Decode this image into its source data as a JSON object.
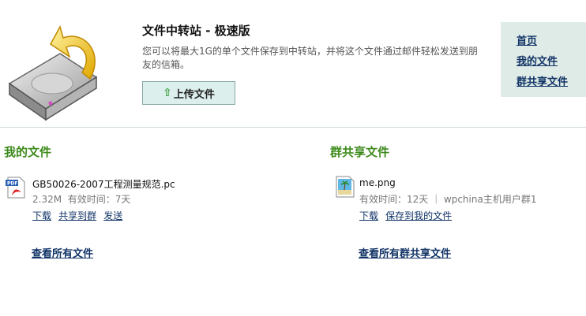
{
  "header": {
    "title": "文件中转站 - 极速版",
    "description": "您可以将最大1G的单个文件保存到中转站，并将这个文件通过邮件轻松发送到朋友的信箱。",
    "upload_label": "上传文件"
  },
  "nav": {
    "items": [
      "首页",
      "我的文件",
      "群共享文件"
    ]
  },
  "my_files": {
    "title": "我的文件",
    "file": {
      "name": "GB50026-2007工程测量规范.pc",
      "size": "2.32M",
      "validity": "有效时间：7天",
      "actions": [
        "下载",
        "共享到群",
        "发送"
      ]
    },
    "view_all": "查看所有文件"
  },
  "group_files": {
    "title": "群共享文件",
    "file": {
      "name": "me.png",
      "meta": "有效时间：12天 ｜ wpchina主机用户群1",
      "actions": [
        "下载",
        "保存到我的文件"
      ]
    },
    "view_all": "查看所有群共享文件"
  },
  "icons": {
    "hero": "hard-drive-upload-icon",
    "pdf": "pdf-file-icon",
    "image": "image-file-icon",
    "upload_arrow": "up-arrow-icon"
  },
  "colors": {
    "section_title": "#3d8a1b",
    "link": "#113366",
    "nav_bg": "#dfebe6",
    "button_bg": "#dcefec"
  }
}
